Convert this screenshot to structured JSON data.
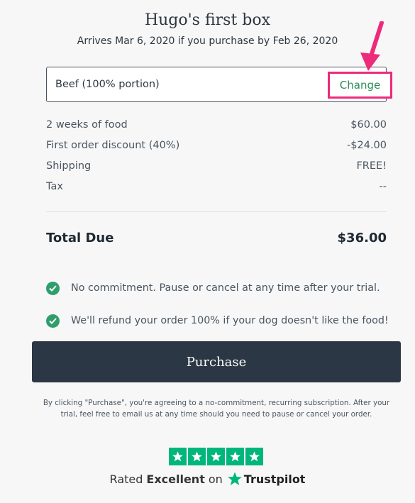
{
  "header": {
    "title": "Hugo's first box",
    "subtitle": "Arrives Mar 6, 2020 if you purchase by Feb 26, 2020"
  },
  "product": {
    "label": "Beef (100% portion)",
    "change_label": "Change"
  },
  "line_items": [
    {
      "label": "2 weeks of food",
      "value": "$60.00"
    },
    {
      "label": "First order discount (40%)",
      "value": "-$24.00"
    },
    {
      "label": "Shipping",
      "value": "FREE!"
    },
    {
      "label": "Tax",
      "value": "--"
    }
  ],
  "total": {
    "label": "Total Due",
    "value": "$36.00"
  },
  "benefits": [
    "No commitment. Pause or cancel at any time after your trial.",
    "We'll refund your order 100% if your dog doesn't like the food!"
  ],
  "purchase_label": "Purchase",
  "disclaimer": "By clicking \"Purchase\", you're agreeing to a no-commitment, recurring subscription. After your trial, feel free to email us at any time should you need to pause or cancel your order.",
  "trustpilot": {
    "prefix": "Rated",
    "rating_word": "Excellent",
    "on": "on",
    "brand": "Trustpilot",
    "stars": 5
  },
  "colors": {
    "accent_green": "#2f9e6a",
    "trustpilot_green": "#00b67a",
    "button_dark": "#2b3744",
    "highlight_pink": "#ee2a7b"
  }
}
